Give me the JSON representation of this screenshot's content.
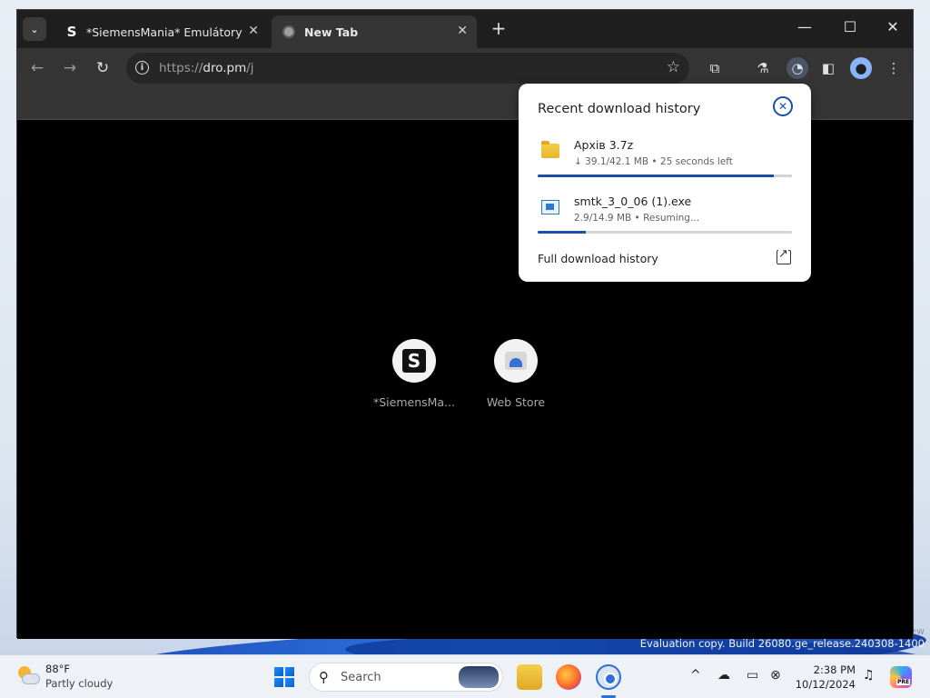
{
  "window": {
    "tabs": [
      {
        "label": "*SiemensMania* Emulátory",
        "favicon": "S",
        "active": false
      },
      {
        "label": "New Tab",
        "active": true
      }
    ],
    "controls": {
      "minimize": "—",
      "maximize": "☐",
      "close": "✕"
    }
  },
  "toolbar": {
    "url_scheme": "https://",
    "url_host": "dro.pm",
    "url_path": "/j"
  },
  "shortcuts": [
    {
      "label": "*SiemensMa...",
      "icon": "siemensmania-logo"
    },
    {
      "label": "Web Store",
      "icon": "web-store-icon"
    }
  ],
  "downloads": {
    "title": "Recent download history",
    "items": [
      {
        "name": "Архів 3.7z",
        "status": "↓ 39.1/42.1 MB • 25 seconds left",
        "progress": 0.93,
        "icon": "folder-archive-icon"
      },
      {
        "name": "smtk_3_0_06 (1).exe",
        "status": "2.9/14.9 MB • Resuming...",
        "progress": 0.19,
        "icon": "exe-icon"
      }
    ],
    "full_history_label": "Full download history"
  },
  "desktop": {
    "watermark": "Evaluation copy. Build 26080.ge_release.240308-1400",
    "corner_text": "ew"
  },
  "taskbar": {
    "temperature": "88°F",
    "condition": "Partly cloudy",
    "search_label": "Search",
    "time": "2:38 PM",
    "date": "10/12/2024",
    "copilot_badge": "PRE"
  },
  "colors": {
    "accent": "#1a4fa8",
    "browser_bg": "#000000",
    "tabstrip": "#1f1f1f",
    "toolbar": "#353535"
  }
}
